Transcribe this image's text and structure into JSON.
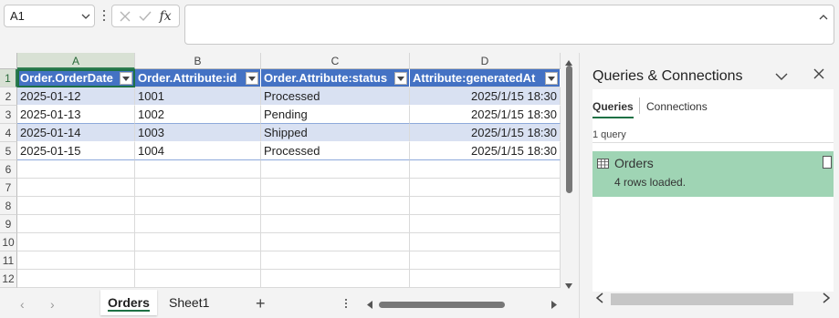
{
  "formula_bar": {
    "name_box": "A1",
    "cancel_icon": "x-icon",
    "enter_icon": "check-icon",
    "fx_label": "fx",
    "formula_value": ""
  },
  "grid": {
    "columns": [
      "A",
      "B",
      "C",
      "D"
    ],
    "rows": [
      "1",
      "2",
      "3",
      "4",
      "5",
      "6",
      "7",
      "8",
      "9",
      "10",
      "11",
      "12"
    ],
    "headers": [
      "Order.OrderDate",
      "Order.Attribute:id",
      "Order.Attribute:status",
      "Attribute:generatedAt"
    ],
    "data": [
      [
        "2025-01-12",
        "1001",
        "Processed",
        "2025/1/15 18:30"
      ],
      [
        "2025-01-13",
        "1002",
        "Pending",
        "2025/1/15 18:30"
      ],
      [
        "2025-01-14",
        "1003",
        "Shipped",
        "2025/1/15 18:30"
      ],
      [
        "2025-01-15",
        "1004",
        "Processed",
        "2025/1/15 18:30"
      ]
    ]
  },
  "sheet_tabs": {
    "tabs": [
      "Orders",
      "Sheet1"
    ],
    "active": "Orders",
    "add_label": "+"
  },
  "panel": {
    "title": "Queries & Connections",
    "tabs": [
      "Queries",
      "Connections"
    ],
    "count": "1 query",
    "query_name": "Orders",
    "query_status": "4 rows loaded."
  },
  "colors": {
    "table_header": "#4472c4",
    "band": "#d9e1f2",
    "query_bg": "#9fd4b4",
    "accent": "#1e7145"
  }
}
